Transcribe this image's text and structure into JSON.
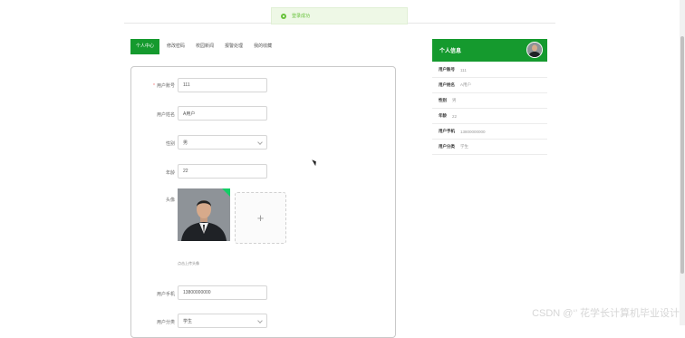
{
  "toast": {
    "message": "登录成功"
  },
  "tabs": [
    {
      "label": "个人中心",
      "active": true
    },
    {
      "label": "修改密码"
    },
    {
      "label": "校园新闻"
    },
    {
      "label": "报警处理"
    },
    {
      "label": "我的收藏"
    }
  ],
  "form": {
    "account_label": "用户账号",
    "account_value": "111",
    "name_label": "用户姓名",
    "name_value": "A用户",
    "gender_label": "性别",
    "gender_value": "男",
    "age_label": "年龄",
    "age_value": "22",
    "avatar_label": "头像",
    "upload_plus": "+",
    "upload_tip": "点击上传头像",
    "phone_label": "用户手机",
    "phone_value": "13800000000",
    "type_label": "用户分类",
    "type_value": "学生"
  },
  "profile": {
    "title": "个人信息",
    "rows": [
      {
        "key": "用户账号",
        "value": "111"
      },
      {
        "key": "用户姓名",
        "value": "A用户"
      },
      {
        "key": "性别",
        "value": "男"
      },
      {
        "key": "年龄",
        "value": "22"
      },
      {
        "key": "用户手机",
        "value": "13800000000"
      },
      {
        "key": "用户分类",
        "value": "学生"
      }
    ]
  },
  "watermark": "CSDN @‘’ 花学长计算机毕业设计",
  "colors": {
    "accent": "#159a2e",
    "success": "#67c23a"
  }
}
